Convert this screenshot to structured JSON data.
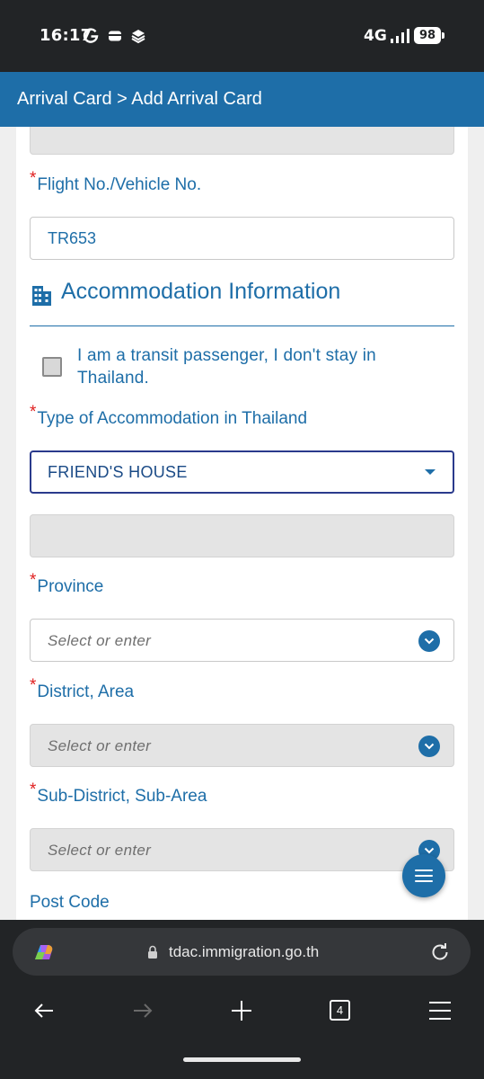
{
  "status_bar": {
    "time": "16:17",
    "network": "4G",
    "battery": "98",
    "icons": [
      "g-icon",
      "wallet-icon",
      "stack-icon",
      "signal-icon",
      "battery-icon"
    ]
  },
  "header": {
    "title": "Arrival Card > Add Arrival Card"
  },
  "form": {
    "flight": {
      "required_mark": "*",
      "label": "Flight No./Vehicle No.",
      "value": "TR653"
    },
    "section": {
      "icon": "building-icon",
      "title": "Accommodation Information"
    },
    "transit": {
      "label": "I am a transit passenger, I don't stay in Thailand.",
      "checked": false
    },
    "accommodation_type": {
      "required_mark": "*",
      "label": "Type of Accommodation in Thailand",
      "value": "FRIEND'S HOUSE"
    },
    "province": {
      "required_mark": "*",
      "label": "Province",
      "placeholder": "Select or enter"
    },
    "district": {
      "required_mark": "*",
      "label": "District, Area",
      "placeholder": "Select or enter"
    },
    "subdistrict": {
      "required_mark": "*",
      "label": "Sub-District, Sub-Area",
      "placeholder": "Select or enter"
    },
    "postcode": {
      "label": "Post Code"
    }
  },
  "browser": {
    "url": "tdac.immigration.go.th",
    "tab_count": "4"
  },
  "colors": {
    "primary": "#1e6ea8",
    "required": "#e02020",
    "disabled_field": "#e4e4e4",
    "chrome_bg": "#222426"
  }
}
